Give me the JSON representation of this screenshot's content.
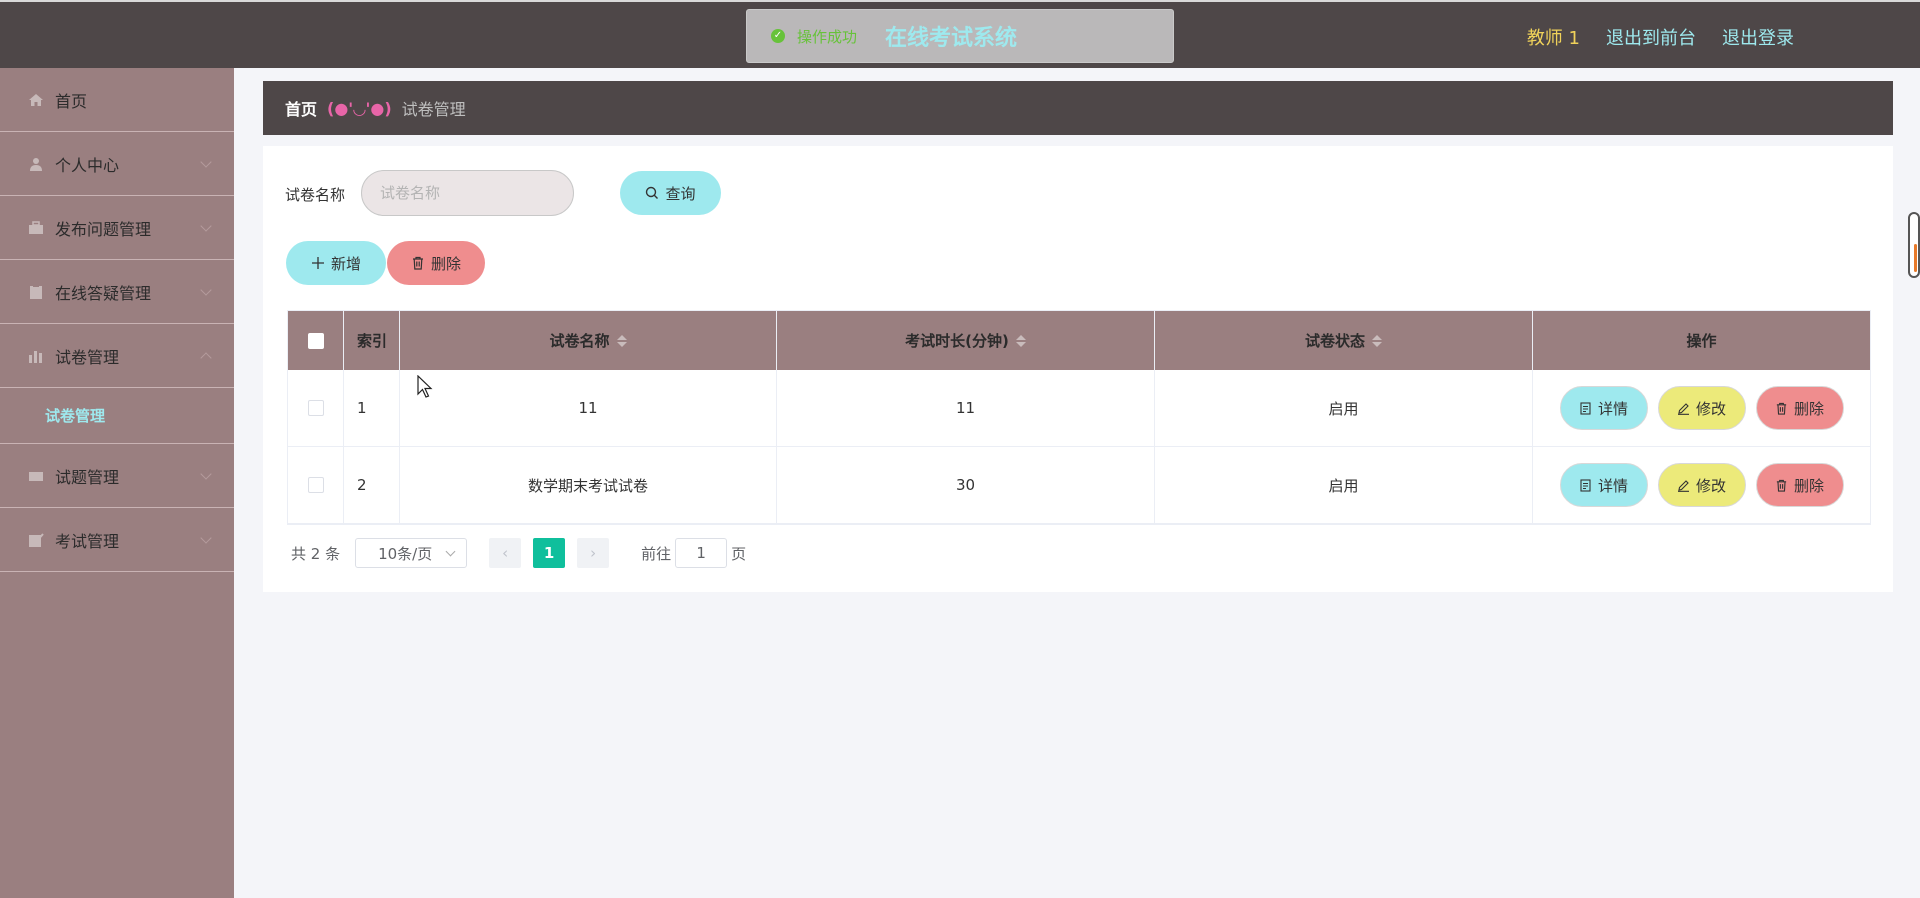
{
  "topbar": {
    "title": "在线考试系统",
    "toast_message": "操作成功",
    "user": "教师 1",
    "front_link": "退出到前台",
    "logout_link": "退出登录"
  },
  "sidebar": {
    "items": [
      {
        "label": "首页",
        "icon": "home-icon"
      },
      {
        "label": "个人中心",
        "icon": "user-icon"
      },
      {
        "label": "发布问题管理",
        "icon": "briefcase-icon"
      },
      {
        "label": "在线答疑管理",
        "icon": "clipboard-icon"
      },
      {
        "label": "试卷管理",
        "icon": "chart-icon"
      },
      {
        "label": "试题管理",
        "icon": "keyboard-icon"
      },
      {
        "label": "考试管理",
        "icon": "edit-icon"
      }
    ],
    "submenu": {
      "label": "试卷管理"
    }
  },
  "breadcrumb": {
    "home": "首页",
    "separator": "(●'◡'●)",
    "current": "试卷管理"
  },
  "search": {
    "label": "试卷名称",
    "placeholder": "试卷名称",
    "query_button": "查询"
  },
  "actions": {
    "add_button": "新增",
    "delete_button": "删除"
  },
  "table": {
    "headers": [
      "索引",
      "试卷名称",
      "考试时长(分钟)",
      "试卷状态",
      "操作"
    ],
    "rows": [
      {
        "index": "1",
        "name": "11",
        "duration": "11",
        "status": "启用"
      },
      {
        "index": "2",
        "name": "数学期末考试试卷",
        "duration": "30",
        "status": "启用"
      }
    ],
    "row_actions": {
      "detail": "详情",
      "edit": "修改",
      "delete": "删除"
    }
  },
  "pagination": {
    "total": "共 2 条",
    "page_size": "10条/页",
    "current_page": "1",
    "goto_label": "前往",
    "goto_value": "1",
    "page_suffix": "页"
  },
  "colors": {
    "header_bg": "#4e4748",
    "sidebar_bg": "#9a7f80",
    "accent_cyan": "#9ee9ee",
    "accent_yellow": "#ecea7a",
    "accent_red": "#ef8d8e",
    "page_active": "#0fbf9c"
  }
}
